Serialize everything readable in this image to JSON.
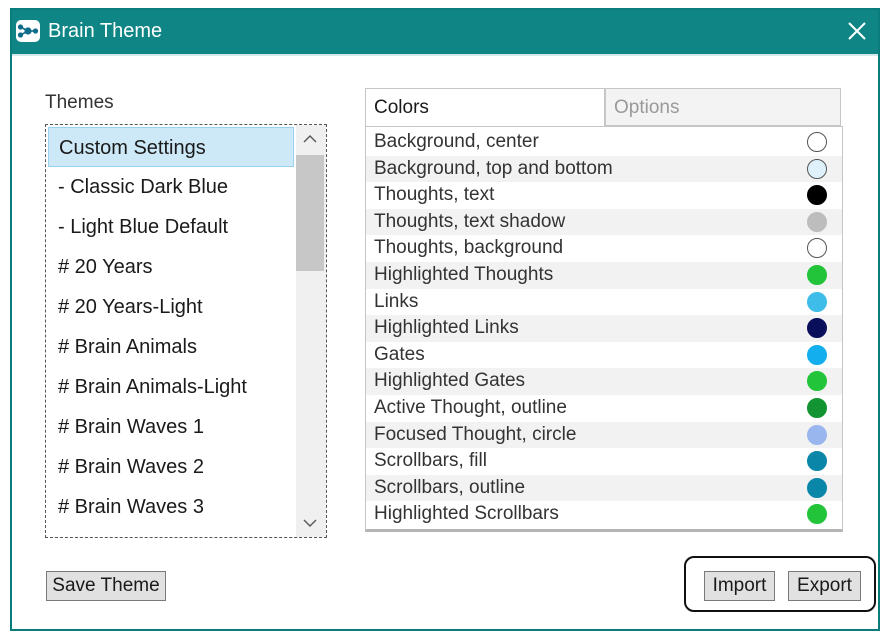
{
  "window": {
    "title": "Brain Theme",
    "app_icon": "brain-logo-icon",
    "close_icon": "close-icon",
    "accent": "#0f8585"
  },
  "themes": {
    "label": "Themes",
    "items": [
      "Custom Settings",
      "- Classic Dark Blue",
      "- Light Blue Default",
      "# 20 Years",
      "# 20 Years-Light",
      "# Brain Animals",
      "# Brain Animals-Light",
      "# Brain Waves 1",
      "# Brain Waves 2",
      "# Brain Waves 3"
    ],
    "selected_index": 0
  },
  "tabs": {
    "colors": "Colors",
    "options": "Options",
    "active": "Colors"
  },
  "colors": [
    {
      "label": "Background, center",
      "color": "#ffffff"
    },
    {
      "label": "Background, top and bottom",
      "color": "#dff2fc"
    },
    {
      "label": "Thoughts, text",
      "color": "#000000"
    },
    {
      "label": "Thoughts, text shadow",
      "color": "#bdbdbd"
    },
    {
      "label": "Thoughts, background",
      "color": "#ffffff"
    },
    {
      "label": "Highlighted Thoughts",
      "color": "#22c43a"
    },
    {
      "label": "Links",
      "color": "#3dbde8"
    },
    {
      "label": "Highlighted Links",
      "color": "#0a0f5c"
    },
    {
      "label": "Gates",
      "color": "#12aeee"
    },
    {
      "label": "Highlighted Gates",
      "color": "#22c43a"
    },
    {
      "label": "Active Thought, outline",
      "color": "#139432"
    },
    {
      "label": "Focused Thought, circle",
      "color": "#9ab6ee"
    },
    {
      "label": "Scrollbars, fill",
      "color": "#0a86a8"
    },
    {
      "label": "Scrollbars, outline",
      "color": "#0a86a8"
    },
    {
      "label": "Highlighted Scrollbars",
      "color": "#22c43a"
    }
  ],
  "buttons": {
    "save": "Save Theme",
    "import": "Import",
    "export": "Export"
  }
}
